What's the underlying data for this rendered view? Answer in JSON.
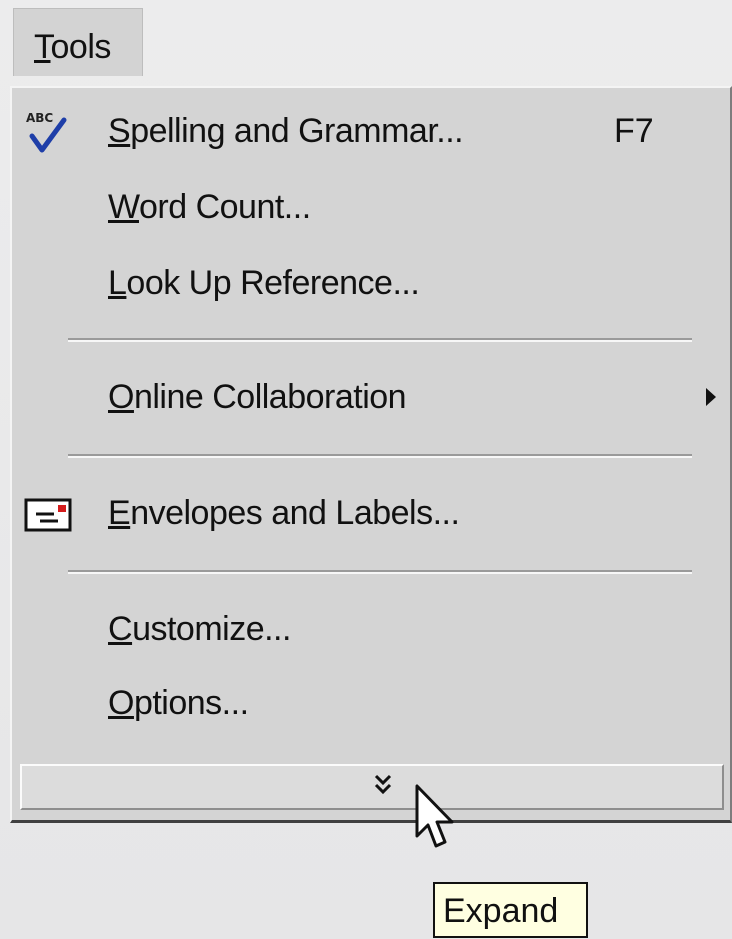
{
  "menubar": {
    "tools_label": "Tools"
  },
  "menu": {
    "items": [
      {
        "label": "Spelling and Grammar...",
        "shortcut": "F7",
        "icon": "spelling-check-icon"
      },
      {
        "label": "Word Count..."
      },
      {
        "label": "Look Up Reference..."
      },
      {
        "label": "Online Collaboration",
        "submenu": true
      },
      {
        "label": "Envelopes and Labels...",
        "icon": "envelope-icon"
      },
      {
        "label": "Customize..."
      },
      {
        "label": "Options..."
      }
    ],
    "expand_icon": "double-chevron-down-icon"
  },
  "tooltip": {
    "text": "Expand"
  },
  "colors": {
    "menu_background": "#d4d4d4",
    "tooltip_background": "#ffffe1",
    "check_blue": "#1e3ea8",
    "envelope_red": "#d41c1c"
  }
}
